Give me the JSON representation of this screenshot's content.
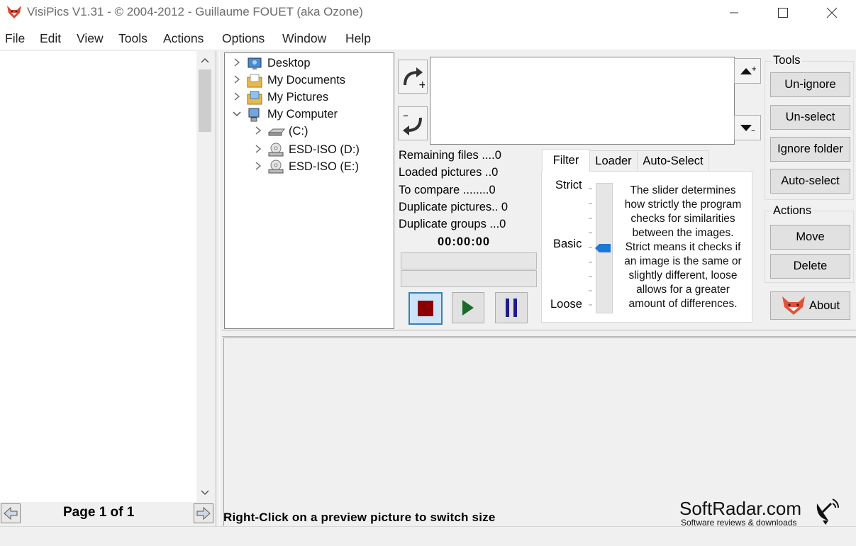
{
  "window": {
    "title": "VisiPics V1.31 - © 2004-2012 - Guillaume FOUET (aka Ozone)",
    "minimize_icon": "minimize-icon",
    "maximize_icon": "maximize-icon",
    "close_icon": "close-icon"
  },
  "menu": [
    "File",
    "Edit",
    "View",
    "Tools",
    "Actions",
    "Options",
    "Window",
    "Help"
  ],
  "tree": {
    "items": [
      {
        "label": "Desktop",
        "expanded": false
      },
      {
        "label": "My Documents",
        "expanded": false
      },
      {
        "label": "My Pictures",
        "expanded": false
      },
      {
        "label": "My Computer",
        "expanded": true
      },
      {
        "label": "(C:)",
        "expanded": false
      },
      {
        "label": "ESD-ISO (D:)",
        "expanded": false
      },
      {
        "label": "ESD-ISO (E:)",
        "expanded": false
      }
    ]
  },
  "stats": {
    "remaining": "Remaining files ....0",
    "loaded": "Loaded pictures ..0",
    "to_compare": "To compare ........0",
    "duplicates": "Duplicate pictures.. 0",
    "groups": "Duplicate groups ...0",
    "timer": "00:00:00"
  },
  "tabs": {
    "items": [
      "Filter",
      "Loader",
      "Auto-Select"
    ],
    "active": "Filter"
  },
  "filter": {
    "strict_label": "Strict",
    "basic_label": "Basic",
    "loose_label": "Loose",
    "level": 0.5,
    "help_lines": [
      "The slider determines",
      "how strictly the program",
      "checks for similarities",
      "between the images.",
      "Strict means it checks if",
      "an image is the same or",
      "slightly different, loose",
      "allows for a greater",
      "amount of differences."
    ]
  },
  "tools": {
    "label": "Tools",
    "unignore": "Un-ignore",
    "unselect": "Un-select",
    "ignore_folder": "Ignore folder",
    "auto_select": "Auto-select"
  },
  "actions": {
    "label": "Actions",
    "move": "Move",
    "delete": "Delete",
    "about": "About"
  },
  "left": {
    "page": "Page 1 of 1"
  },
  "status": {
    "hint": "Right-Click on a preview picture to switch size"
  },
  "watermark": {
    "brand": "SoftRadar.com",
    "tagline": "Software reviews & downloads"
  }
}
